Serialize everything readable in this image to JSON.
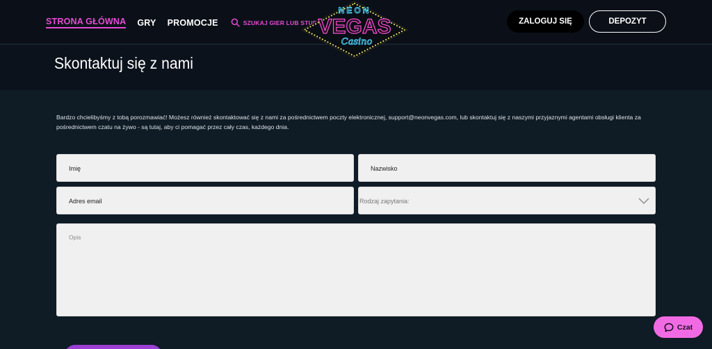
{
  "header": {
    "nav": [
      {
        "label": "STRONA GŁÓWNA",
        "active": true
      },
      {
        "label": "GRY",
        "active": false
      },
      {
        "label": "PROMOCJE",
        "active": false
      }
    ],
    "search_label": "SZUKAJ GIER LUB STUDIA",
    "logo": {
      "top": "NEON",
      "main": "VEGAS",
      "script": "Casino"
    },
    "login_label": "ZALOGUJ SIĘ",
    "deposit_label": "DEPOZYT"
  },
  "page_title": "Skontaktuj się z nami",
  "intro_text": "Bardzo chcielibyśmy z tobą porozmawiać! Możesz również skontaktować się z nami za pośrednictwem poczty elektronicznej, support@neonvegas.com, lub skontaktuj się z naszymi przyjaznymi agentami obsługi klienta za pośrednictwem czatu na żywo - są tutaj, aby ci pomagać przez cały czas, każdego dnia.",
  "form": {
    "first_name": "Imię",
    "last_name": "Nazwisko",
    "email": "Adres email",
    "inquiry_type": "Rodzaj zapytania:",
    "description": "Opis"
  },
  "chat": {
    "label": "Czat"
  },
  "colors": {
    "accent": "#e64bd7",
    "chat": "#f06be3",
    "background": "#0f1b25",
    "header": "#0b1018",
    "logo_neon_blue": "#4fd8ff",
    "logo_neon_pink": "#ff4fd8",
    "logo_lights": "#f3e76a"
  }
}
